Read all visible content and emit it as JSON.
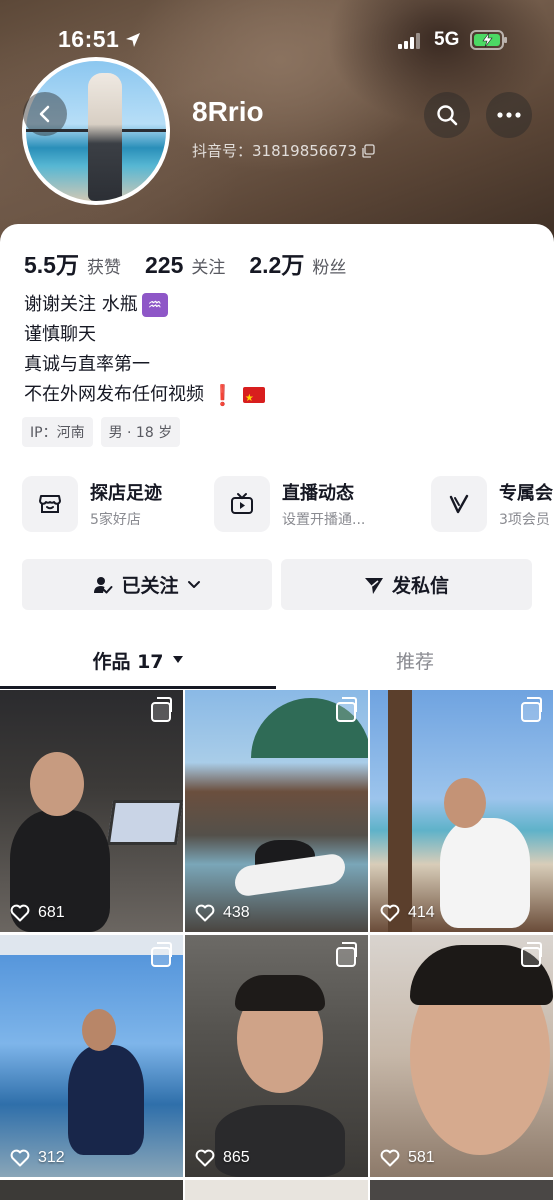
{
  "status_bar": {
    "time": "16:51",
    "network": "5G"
  },
  "profile": {
    "username": "8Rrio",
    "douyin_id": "抖音号：31819856673",
    "stats": [
      {
        "value": "5.5万",
        "label": "获赞"
      },
      {
        "value": "225",
        "label": "关注"
      },
      {
        "value": "2.2万",
        "label": "粉丝"
      }
    ],
    "bio": {
      "line1": "谢谢关注 水瓶",
      "line1_emoji": "♒",
      "line2": "谨慎聊天",
      "line3": "真诚与直率第一",
      "line4": "不在外网发布任何视频",
      "line4_emoji": "❗"
    },
    "tags": [
      "IP：河南",
      "男 · 18 岁"
    ]
  },
  "features": [
    {
      "title": "探店足迹",
      "subtitle": "5家好店",
      "icon": "storefront-icon"
    },
    {
      "title": "直播动态",
      "subtitle": "设置开播通...",
      "icon": "tv-icon"
    },
    {
      "title": "专属会",
      "subtitle": "3项会员",
      "icon": "v-badge-icon"
    }
  ],
  "actions": {
    "follow_label": "已关注",
    "message_label": "发私信"
  },
  "tabs": {
    "works_label": "作品 17",
    "recommend_label": "推荐"
  },
  "videos": [
    {
      "likes": "681"
    },
    {
      "likes": "438"
    },
    {
      "likes": "414"
    },
    {
      "likes": "312"
    },
    {
      "likes": "865"
    },
    {
      "likes": "581"
    }
  ],
  "colors": {
    "primary_text": "#161823",
    "secondary_text": "#8a8b91",
    "button_bg": "#f1f1f3"
  }
}
